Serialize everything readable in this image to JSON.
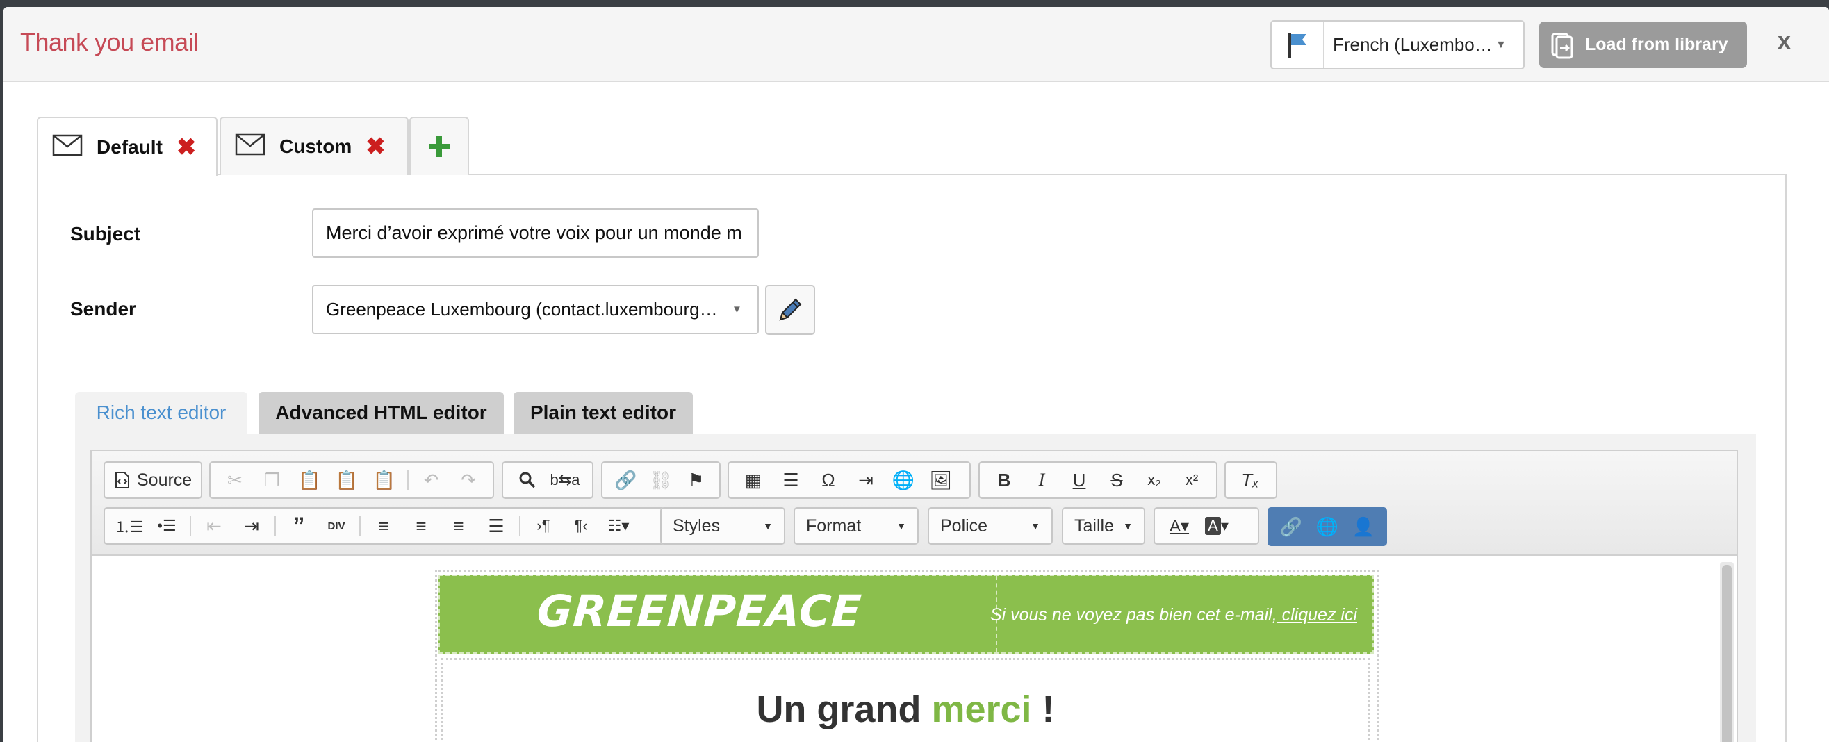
{
  "modal": {
    "title": "Thank you email",
    "language": "French (Luxembo…",
    "load_button": "Load from library",
    "close": "x"
  },
  "tabs": [
    {
      "label": "Default",
      "active": true
    },
    {
      "label": "Custom",
      "active": false
    }
  ],
  "form": {
    "subject_label": "Subject",
    "subject_value": "Merci d’avoir exprimé votre voix pour un monde m",
    "sender_label": "Sender",
    "sender_value": "Greenpeace Luxembourg (contact.luxembourg…"
  },
  "editor_tabs": {
    "rich": "Rich text editor",
    "advanced": "Advanced HTML editor",
    "plain": "Plain text editor"
  },
  "toolbar": {
    "source": "Source",
    "styles": "Styles",
    "format": "Format",
    "font": "Police",
    "size": "Taille"
  },
  "email": {
    "logo": "GREENPEACE",
    "note": "Si vous ne voyez pas bien cet e-mail,",
    "note_link": " cliquez ici",
    "headline_a": "Un grand ",
    "headline_b": "merci",
    "headline_c": " !"
  },
  "colors": {
    "title": "#c64a56",
    "greenpeace_green": "#8bbf4d",
    "accent_blue": "#4a90cf",
    "delete_red": "#cc1f1f"
  }
}
